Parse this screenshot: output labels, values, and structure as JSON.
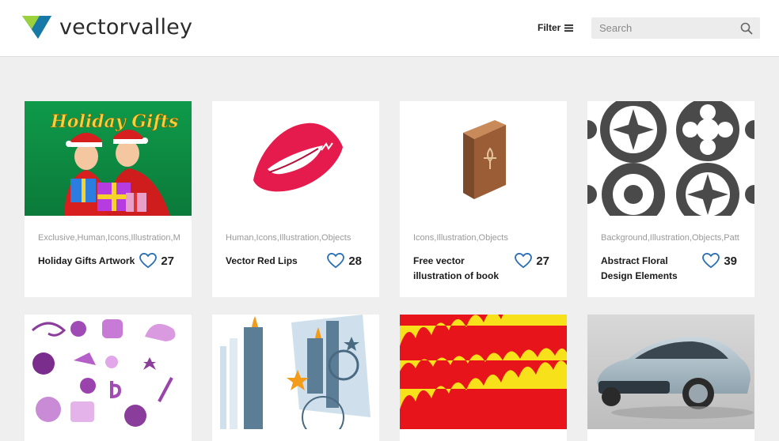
{
  "brand": {
    "name": "vectorvalley"
  },
  "header": {
    "filter_label": "Filter",
    "search_placeholder": "Search"
  },
  "cards": [
    {
      "tags": "Exclusive,Human,Icons,Illustration,M",
      "title": "Holiday Gifts Artwork",
      "likes": "27",
      "thumb": "holiday-gifts"
    },
    {
      "tags": "Human,Icons,Illustration,Objects",
      "title": "Vector Red Lips",
      "likes": "28",
      "thumb": "red-lips"
    },
    {
      "tags": "Icons,Illustration,Objects",
      "title": "Free vector illustration of book",
      "likes": "27",
      "thumb": "book"
    },
    {
      "tags": "Background,Illustration,Objects,Patt",
      "title": "Abstract Floral Design Elements",
      "likes": "39",
      "thumb": "floral"
    },
    {
      "thumb": "purple-icons"
    },
    {
      "thumb": "candles-city"
    },
    {
      "thumb": "flames"
    },
    {
      "thumb": "car"
    }
  ],
  "thumb_texts": {
    "holiday_gifts": "Holiday Gifts"
  },
  "colors": {
    "accent": "#2a6fb5",
    "logo_green": "#8bc53f",
    "logo_teal": "#1a7f8f"
  }
}
